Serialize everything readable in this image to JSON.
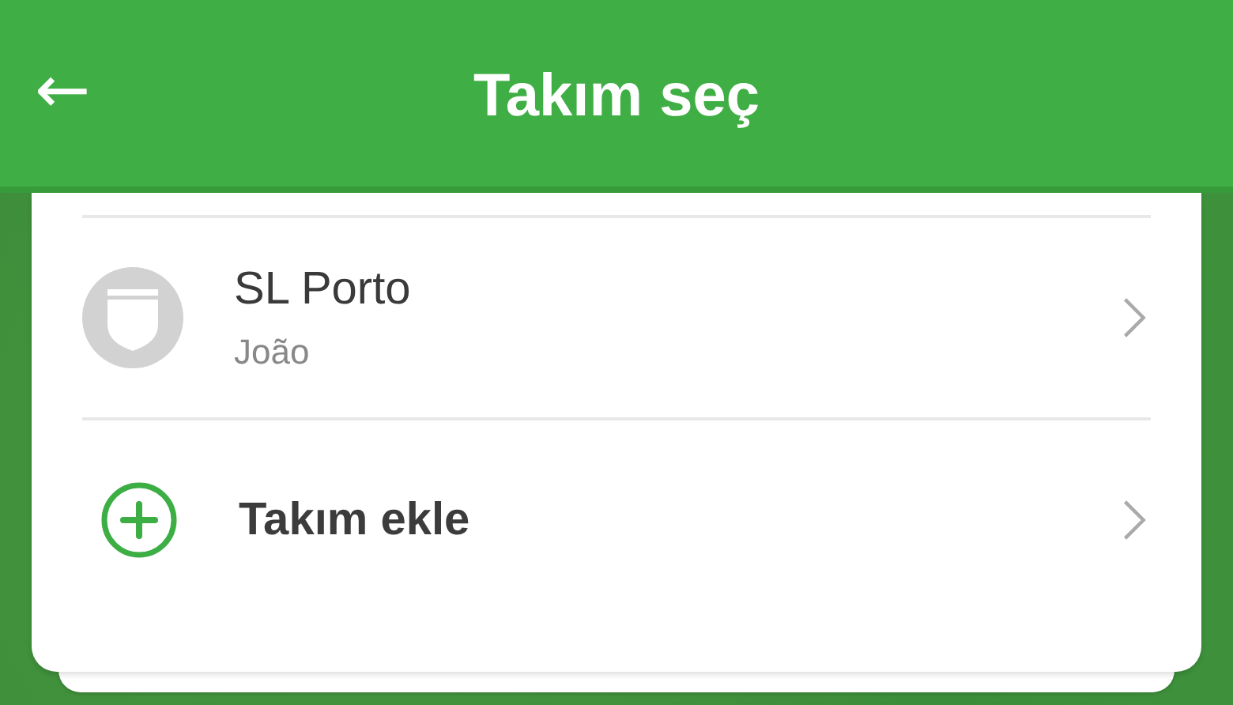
{
  "header": {
    "back_icon": "←",
    "title": "Takım seç"
  },
  "items": [
    {
      "kind": "team",
      "name": "SL Porto",
      "owner": "João"
    },
    {
      "kind": "add",
      "name": "Takım ekle"
    }
  ]
}
